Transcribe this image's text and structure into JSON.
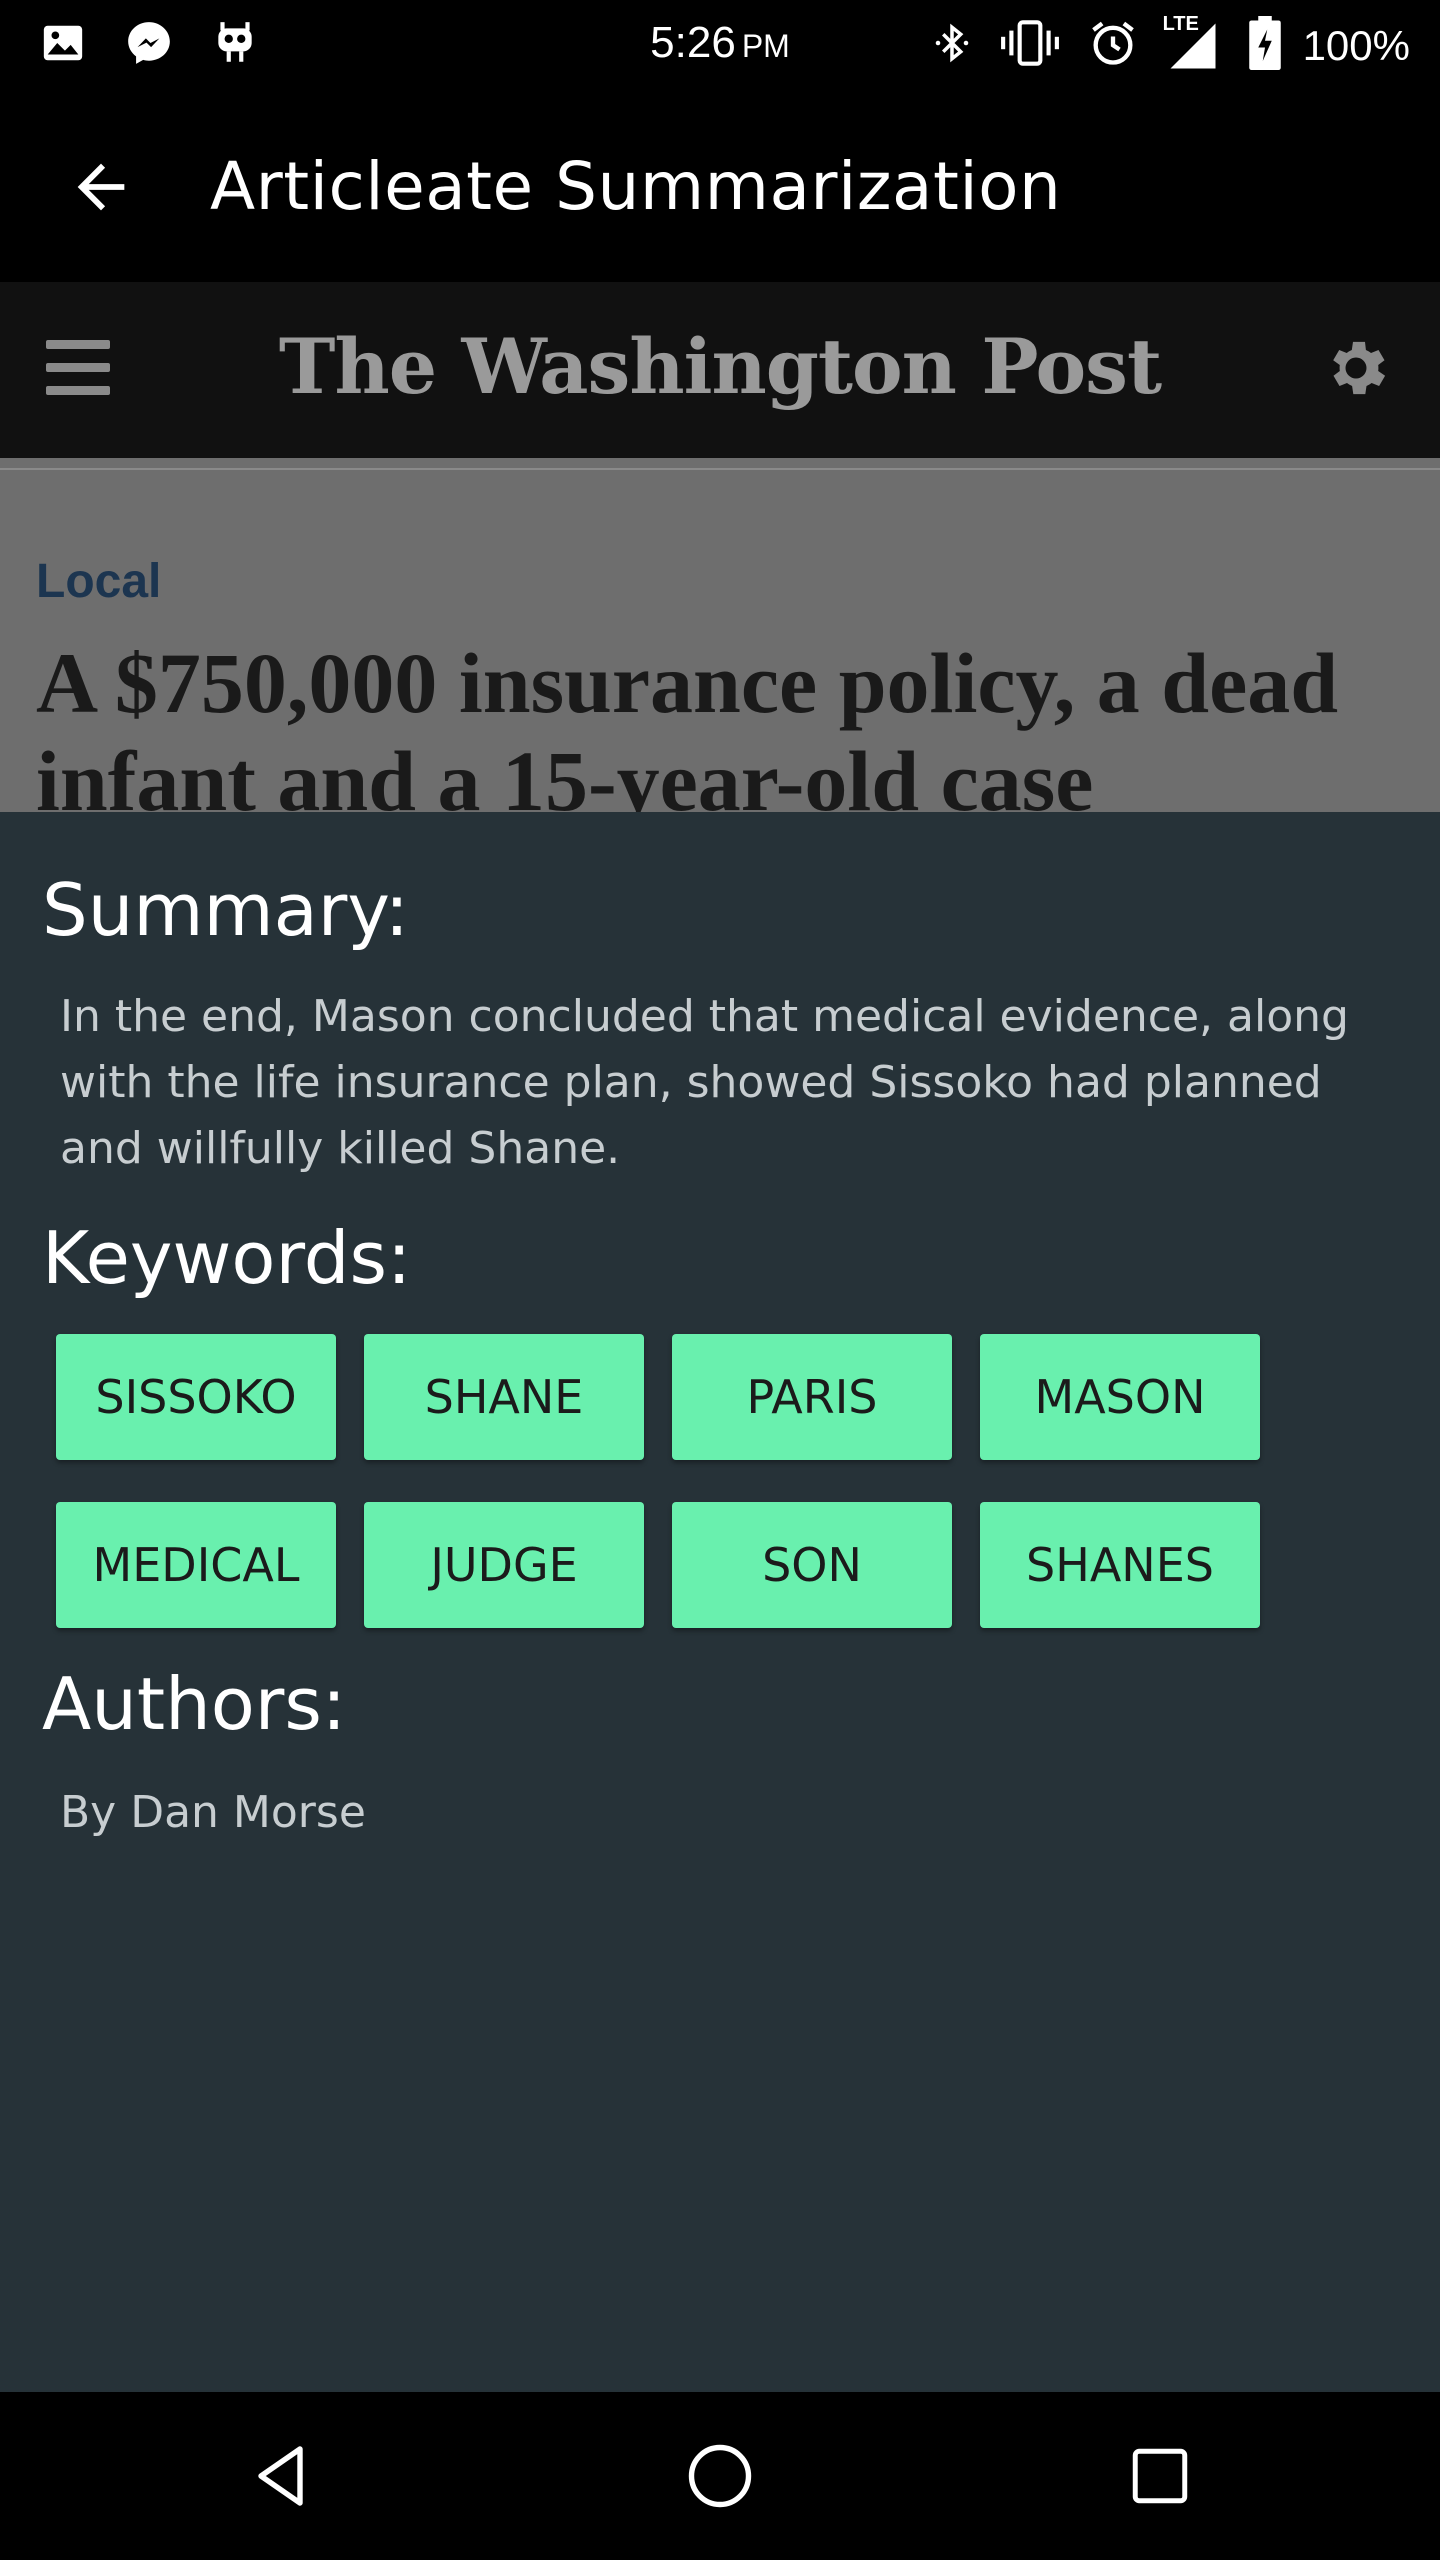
{
  "status_bar": {
    "time": "5:26",
    "ampm": "PM",
    "battery": "100%",
    "network": "LTE",
    "icons_left": [
      "image-icon",
      "messenger-icon",
      "robot-icon"
    ],
    "icons_right": [
      "bluetooth-icon",
      "vibrate-icon",
      "alarm-icon",
      "signal-icon",
      "battery-icon"
    ]
  },
  "app_bar": {
    "title": "Articleate Summarization"
  },
  "webview": {
    "logo": "The Washington Post",
    "section": "Local",
    "headline": "A $750,000 insurance policy, a dead infant and a 15-year-old case"
  },
  "sheet": {
    "summary_heading": "Summary:",
    "summary_text": "In the end, Mason concluded that medical evidence, along with the life insurance plan, showed Sissoko had planned and willfully killed Shane.",
    "keywords_heading": "Keywords:",
    "keywords": [
      "SISSOKO",
      "SHANE",
      "PARIS",
      "MASON",
      "MEDICAL",
      "JUDGE",
      "SON",
      "SHANES"
    ],
    "authors_heading": "Authors:",
    "authors_text": "By Dan Morse"
  },
  "colors": {
    "sheet_bg": "#263238",
    "keyword_bg": "#69f0ae",
    "bar_bg": "#000000",
    "section_label": "#1c3550"
  }
}
